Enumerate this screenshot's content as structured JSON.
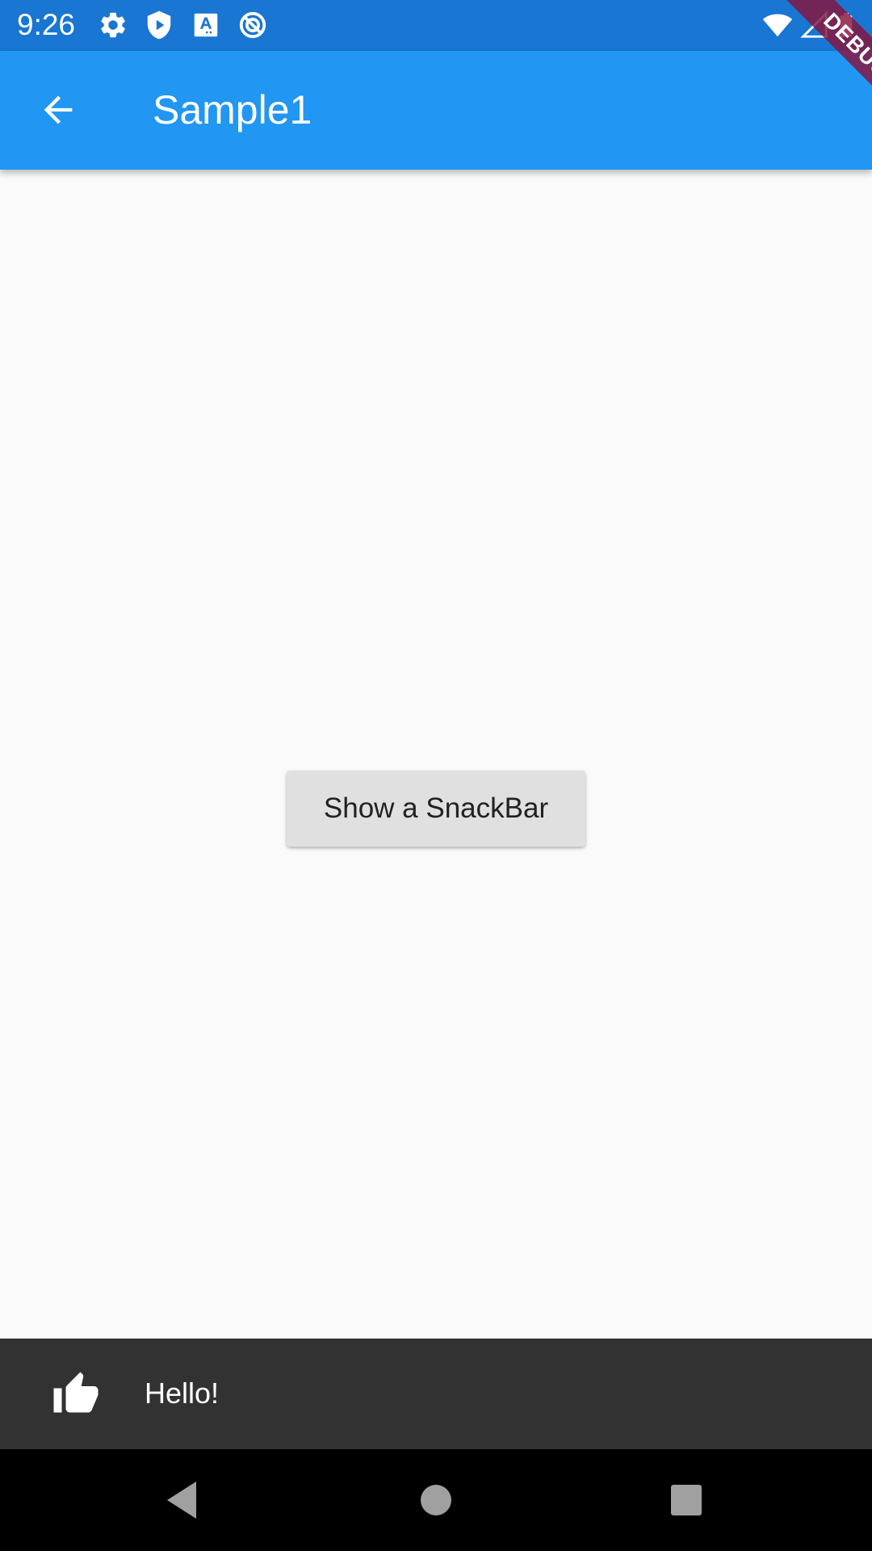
{
  "status_bar": {
    "time": "9:26",
    "icons": [
      "settings-icon",
      "shield-play-icon",
      "font-a-icon",
      "no-sync-icon",
      "wifi-icon",
      "signal-icon",
      "battery-icon"
    ]
  },
  "app_bar": {
    "title": "Sample1",
    "back_icon": "arrow-back-icon"
  },
  "debug_banner": "DEBUG",
  "body": {
    "button_label": "Show a SnackBar"
  },
  "snackbar": {
    "icon": "thumb-up-icon",
    "message": "Hello!"
  },
  "nav_bar": {
    "buttons": [
      "back-triangle-icon",
      "home-circle-icon",
      "recents-square-icon"
    ]
  },
  "colors": {
    "status_bar": "#1976d2",
    "app_bar": "#2196f3",
    "background": "#fafafa",
    "button": "#e0e0e0",
    "snackbar": "#323232",
    "nav_bar": "#000000",
    "debug_ribbon": "#88143c"
  }
}
